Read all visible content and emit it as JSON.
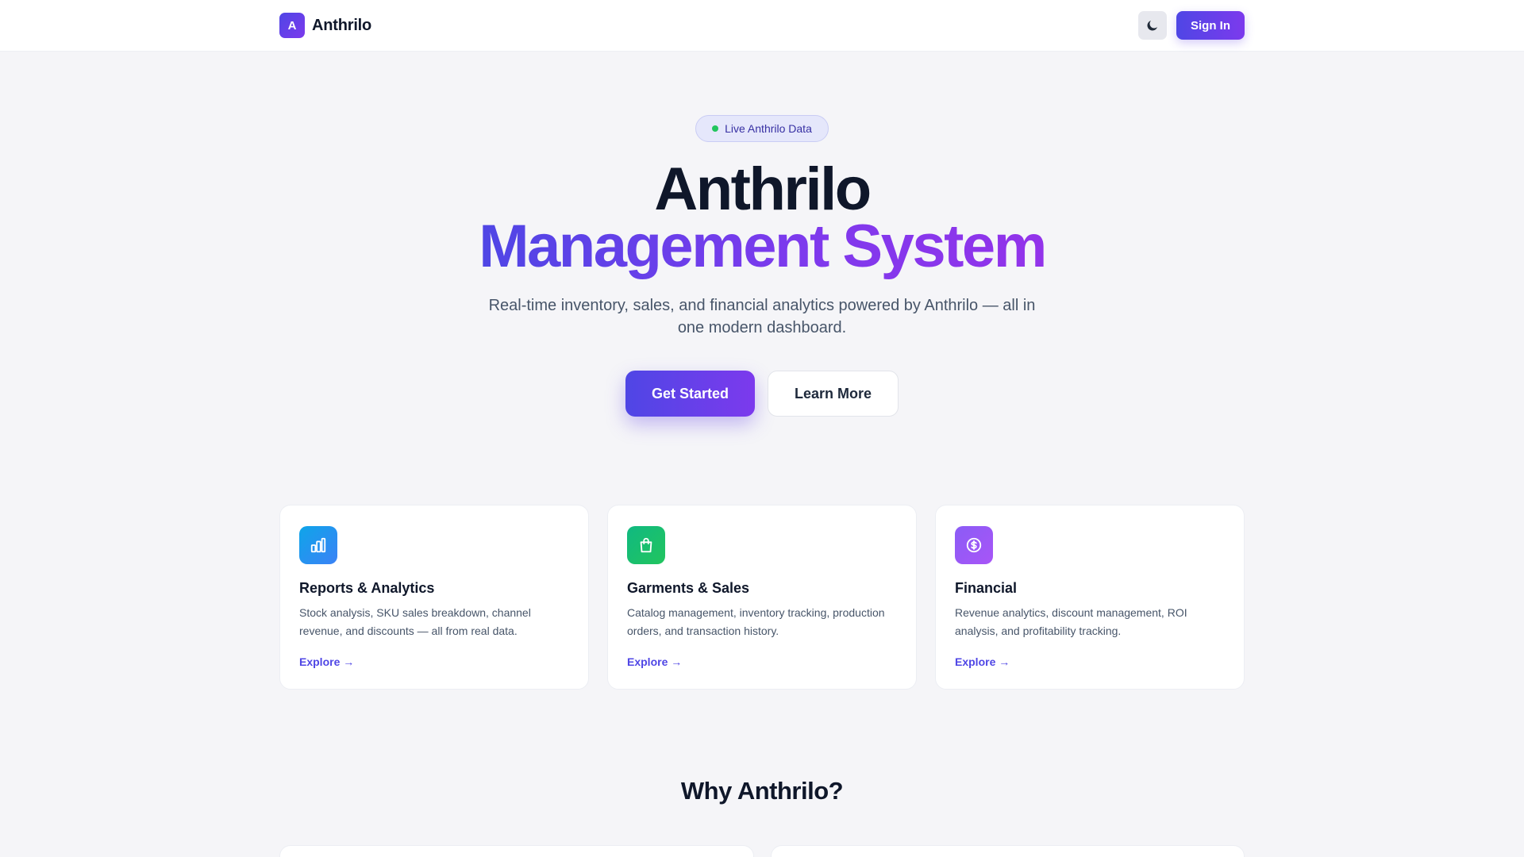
{
  "header": {
    "brand_letter": "A",
    "brand_name": "Anthrilo",
    "theme_toggle_icon": "moon-icon",
    "signin_label": "Sign In"
  },
  "hero": {
    "badge": "Live Anthrilo Data",
    "title_line1": "Anthrilo",
    "title_line2": "Management System",
    "subtitle": "Real-time inventory, sales, and financial analytics powered by Anthrilo — all in one modern dashboard.",
    "primary_cta": "Get Started",
    "secondary_cta": "Learn More"
  },
  "features": [
    {
      "icon": "bar-chart-icon",
      "title": "Reports & Analytics",
      "description": "Stock analysis, SKU sales breakdown, channel revenue, and discounts — all from real data.",
      "link": "Explore →",
      "color": "#0ea5e9"
    },
    {
      "icon": "shopping-bag-icon",
      "title": "Garments & Sales",
      "description": "Catalog management, inventory tracking, production orders, and transaction history.",
      "link": "Explore →",
      "color": "#10b981"
    },
    {
      "icon": "dollar-circle-icon",
      "title": "Financial",
      "description": "Revenue analytics, discount management, ROI analysis, and profitability tracking.",
      "link": "Explore →",
      "color": "#8b5cf6"
    }
  ],
  "why": {
    "title": "Why Anthrilo?"
  },
  "colors": {
    "accent": "#4f46e5",
    "accent_2": "#7c3aed",
    "background": "#f5f5f8",
    "live_dot": "#22c55e"
  }
}
